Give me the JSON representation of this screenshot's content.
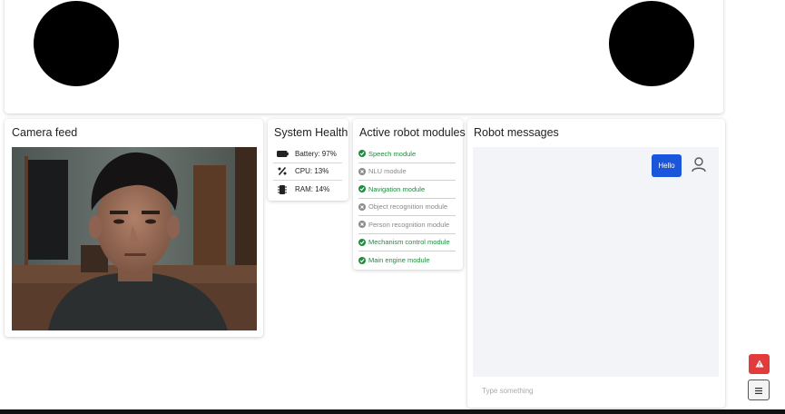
{
  "camera": {
    "title": "Camera feed"
  },
  "health": {
    "title": "System Health",
    "items": [
      {
        "icon": "battery-icon",
        "label": "Battery: 97%"
      },
      {
        "icon": "cpu-percent-icon",
        "label": "CPU: 13%"
      },
      {
        "icon": "memory-chip-icon",
        "label": "RAM: 14%"
      }
    ]
  },
  "modules": {
    "title": "Active robot modules",
    "items": [
      {
        "label": "Speech module",
        "status": "active"
      },
      {
        "label": "NLU module",
        "status": "inactive"
      },
      {
        "label": "Navigation module",
        "status": "active"
      },
      {
        "label": "Object recognition module",
        "status": "inactive"
      },
      {
        "label": "Person recognition module",
        "status": "inactive"
      },
      {
        "label": "Mechanism control module",
        "status": "active"
      },
      {
        "label": "Main engine module",
        "status": "active"
      }
    ]
  },
  "messages": {
    "title": "Robot messages",
    "bubble": "Hello",
    "input_placeholder": "Type something"
  },
  "colors": {
    "active": "#1e8e3e",
    "inactive": "#888888",
    "bubble": "#1a56db",
    "alert": "#e23b3b",
    "eye": "#000000"
  },
  "icons": {
    "alert": "warning-triangle-icon",
    "menu": "hamburger-menu-icon",
    "avatar": "user-outline-icon"
  }
}
